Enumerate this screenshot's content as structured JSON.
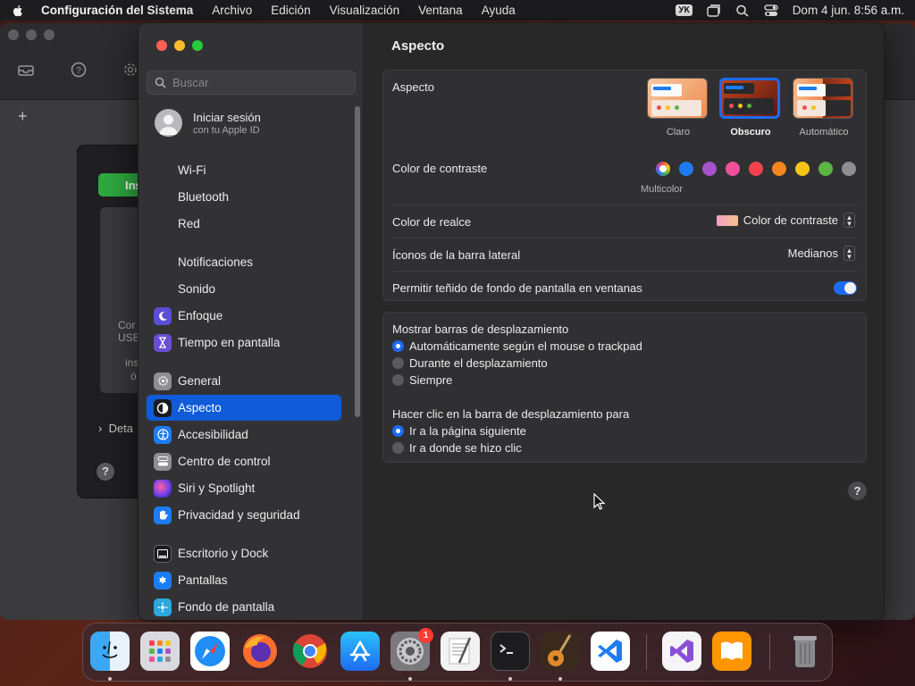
{
  "menubar": {
    "app_name": "Configuración del Sistema",
    "items": [
      "Archivo",
      "Edición",
      "Visualización",
      "Ventana",
      "Ayuda"
    ],
    "keyboard_badge": "УК",
    "datetime": "Dom 4 jun.  8:56 a.m.",
    "icons": [
      "apple-icon",
      "window-icon",
      "search-icon",
      "control-center-icon"
    ]
  },
  "background_window": {
    "button_text": "Ins",
    "texts": [
      "Cor",
      "USB",
      "ins",
      "ó"
    ],
    "detail_label": "Deta",
    "help": "?",
    "add": "+"
  },
  "sidebar": {
    "search_placeholder": "Buscar",
    "account": {
      "title": "Iniciar sesión",
      "subtitle": "con tu Apple ID"
    },
    "items": [
      {
        "label": "Wi-Fi",
        "icon": "wifi-icon"
      },
      {
        "label": "Bluetooth",
        "icon": "bluetooth-icon"
      },
      {
        "label": "Red",
        "icon": "network-icon"
      },
      {
        "label": "Notificaciones",
        "icon": "notifications-icon"
      },
      {
        "label": "Sonido",
        "icon": "sound-icon"
      },
      {
        "label": "Enfoque",
        "icon": "moon-icon"
      },
      {
        "label": "Tiempo en pantalla",
        "icon": "hourglass-icon"
      },
      {
        "label": "General",
        "icon": "gear-icon"
      },
      {
        "label": "Aspecto",
        "icon": "appearance-icon"
      },
      {
        "label": "Accesibilidad",
        "icon": "accessibility-icon"
      },
      {
        "label": "Centro de control",
        "icon": "control-center-icon"
      },
      {
        "label": "Siri y Spotlight",
        "icon": "siri-icon"
      },
      {
        "label": "Privacidad y seguridad",
        "icon": "hand-icon"
      },
      {
        "label": "Escritorio y Dock",
        "icon": "dock-icon"
      },
      {
        "label": "Pantallas",
        "icon": "display-icon"
      },
      {
        "label": "Fondo de pantalla",
        "icon": "wallpaper-icon"
      }
    ],
    "selected": "Aspecto"
  },
  "content": {
    "title": "Aspecto",
    "appearance": {
      "label": "Aspecto",
      "options": [
        "Claro",
        "Obscuro",
        "Automático"
      ],
      "selected": "Obscuro"
    },
    "accent": {
      "label": "Color de contraste",
      "selected_caption": "Multicolor",
      "colors": [
        "#d94fd8",
        "#1f7bf2",
        "#a652c8",
        "#f04f9a",
        "#f0424c",
        "#f5861f",
        "#f5c518",
        "#5ab545",
        "#8e8e93"
      ]
    },
    "highlight": {
      "label": "Color de realce",
      "value": "Color de contraste"
    },
    "sidebar_icons": {
      "label": "Íconos de la barra lateral",
      "value": "Medianos"
    },
    "wallpaper_tinting": {
      "label": "Permitir teñido de fondo de pantalla en ventanas",
      "enabled": true
    },
    "scrollbars": {
      "label": "Mostrar barras de desplazamiento",
      "options": [
        "Automáticamente según el mouse o trackpad",
        "Durante el desplazamiento",
        "Siempre"
      ],
      "selected": 0
    },
    "click_scrollbar": {
      "label": "Hacer clic en la barra de desplazamiento para",
      "options": [
        "Ir a la página siguiente",
        "Ir a donde se hizo clic"
      ],
      "selected": 0
    },
    "help": "?"
  },
  "dock": {
    "apps": [
      {
        "name": "Finder",
        "icon": "finder-icon",
        "color": "#1e9bf0"
      },
      {
        "name": "Launchpad",
        "icon": "launchpad-icon",
        "color": "#d9dadf"
      },
      {
        "name": "Safari",
        "icon": "safari-icon",
        "color": "#1f8ef5"
      },
      {
        "name": "Firefox",
        "icon": "firefox-icon",
        "color": "#ff6d2c"
      },
      {
        "name": "Chrome",
        "icon": "chrome-icon",
        "color": "#e9e9ea"
      },
      {
        "name": "App Store",
        "icon": "app-store-icon",
        "color": "#1d8cf5"
      },
      {
        "name": "Configuración del Sistema",
        "icon": "gear-icon",
        "color": "#8e8e93",
        "badge": "1"
      },
      {
        "name": "TextEdit",
        "icon": "textedit-icon",
        "color": "#f2f2f2"
      },
      {
        "name": "Terminal",
        "icon": "terminal-icon",
        "color": "#1c1c1e"
      },
      {
        "name": "GarageBand",
        "icon": "guitar-icon",
        "color": "#5a3a22"
      },
      {
        "name": "Visual Studio Code",
        "icon": "vscode-icon",
        "color": "#ffffff"
      },
      {
        "name": "Visual Studio",
        "icon": "visual-studio-icon",
        "color": "#f5f5f7"
      },
      {
        "name": "Libros",
        "icon": "books-icon",
        "color": "#ff9500"
      },
      {
        "name": "Papelera",
        "icon": "trash-icon",
        "color": "#7a7a7c"
      }
    ]
  }
}
